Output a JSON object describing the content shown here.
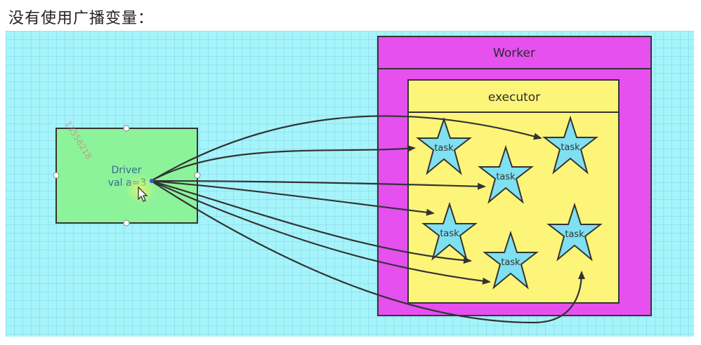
{
  "page": {
    "title": "没有使用广播变量："
  },
  "worker": {
    "label": "Worker"
  },
  "executor": {
    "label": "executor"
  },
  "driver": {
    "label": "Driver",
    "code": "val a=3"
  },
  "tasks": [
    {
      "label": "task"
    },
    {
      "label": "task"
    },
    {
      "label": "task"
    },
    {
      "label": "task"
    },
    {
      "label": "task"
    },
    {
      "label": "task"
    }
  ],
  "watermark": "13556218",
  "colors": {
    "canvas": "#a6f4fb",
    "worker": "#e550ef",
    "executor": "#fdf57a",
    "driver": "#8cf39b",
    "star": "#7ee0f0",
    "stroke": "#333333"
  }
}
